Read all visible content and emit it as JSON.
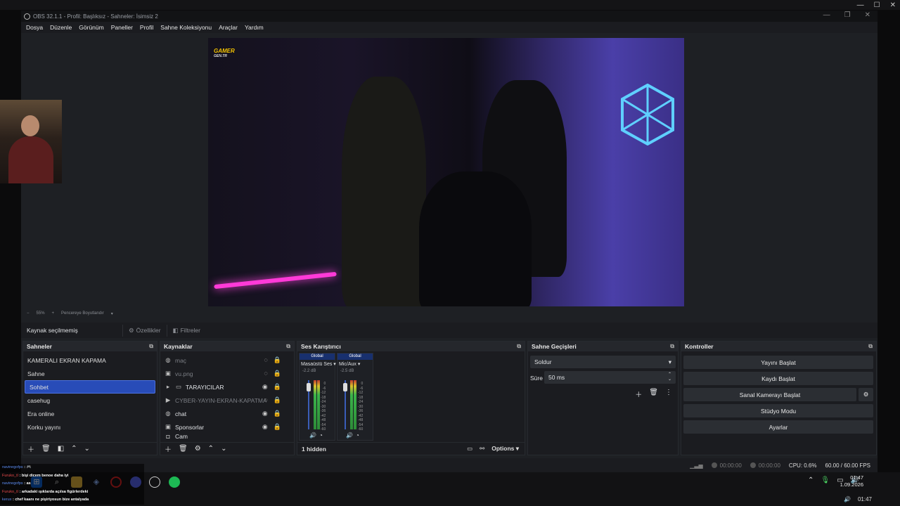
{
  "app": {
    "title": "OBS 32.1.1 - Profil: Başlıksız - Sahneler: İsimsiz 2"
  },
  "menu": [
    "Dosya",
    "Düzenle",
    "Görünüm",
    "Paneller",
    "Profil",
    "Sahne Koleksiyonu",
    "Araçlar",
    "Yardım"
  ],
  "preview": {
    "brand": "GAMER",
    "brand_sub": "GEN.TR",
    "zoom": "55%",
    "zoom_mode": "Pencereye Boyutlandır"
  },
  "source_toolbar": {
    "status": "Kaynak seçilmemiş",
    "properties": "Özellikler",
    "filters": "Filtreler"
  },
  "scenes": {
    "title": "Sahneler",
    "items": [
      "KAMERALI EKRAN KAPAMA",
      "Sahne",
      "Sohbet",
      "casehug",
      "Era online",
      "Korku yayını"
    ],
    "active_index": 2
  },
  "sources": {
    "title": "Kaynaklar",
    "items": [
      {
        "label": "maç",
        "icon": "globe-icon",
        "dim": true,
        "visible": false
      },
      {
        "label": "vu.png",
        "icon": "image-icon",
        "dim": true,
        "visible": false
      },
      {
        "label": "TARAYICILAR",
        "icon": "folder-icon",
        "dim": false,
        "visible": true
      },
      {
        "label": "CYBER-YAYIN-EKRAN-KAPATMA.m",
        "icon": "play-icon",
        "dim": true,
        "visible": false
      },
      {
        "label": "chat",
        "icon": "globe-icon",
        "dim": false,
        "visible": true
      },
      {
        "label": "Sponsorlar",
        "icon": "image-icon",
        "dim": false,
        "visible": true
      },
      {
        "label": "Cam",
        "icon": "camera-icon",
        "dim": false,
        "visible": true
      }
    ]
  },
  "mixer": {
    "title": "Ses Karıştırıcı",
    "channels": [
      {
        "badge": "Global",
        "name": "Masaüstü Ses",
        "db": "-2.2 dB"
      },
      {
        "badge": "Global",
        "name": "Mic/Aux",
        "db": "-2.5 dB"
      }
    ],
    "scale": [
      "0",
      "-6",
      "-12",
      "-18",
      "-24",
      "-30",
      "-36",
      "-42",
      "-48",
      "-54",
      "-60"
    ],
    "hidden": "1 hidden",
    "options": "Options"
  },
  "transitions": {
    "title": "Sahne Geçişleri",
    "selected": "Soldur",
    "duration_label": "Süre",
    "duration": "50 ms"
  },
  "controls": {
    "title": "Kontroller",
    "start_stream": "Yayını Başlat",
    "start_record": "Kaydı Başlat",
    "virtual_cam": "Sanal Kamerayı Başlat",
    "studio_mode": "Stüdyo Modu",
    "settings": "Ayarlar"
  },
  "status": {
    "stream_time": "00:00:00",
    "rec_time": "00:00:00",
    "cpu": "CPU: 0.6%",
    "fps": "60.00 / 60.00 FPS"
  },
  "chat": [
    {
      "user": "navinegofps",
      "msg": ": 🎮"
    },
    {
      "user": "Furuko_tl",
      "msg": ": bişi dicem benoe daha iyi"
    },
    {
      "user": "navinegofps",
      "msg": ": as"
    },
    {
      "user": "Furuko_tl",
      "msg": ": arkadaki ışıklarda açılsa figürlerdeki"
    },
    {
      "user": "kerux",
      "msg": ": chef kaanı ne pişiriyosun bize antalyada"
    }
  ],
  "clock": {
    "time": "01:47",
    "date": "1.09.2026",
    "time2": "01:47"
  }
}
